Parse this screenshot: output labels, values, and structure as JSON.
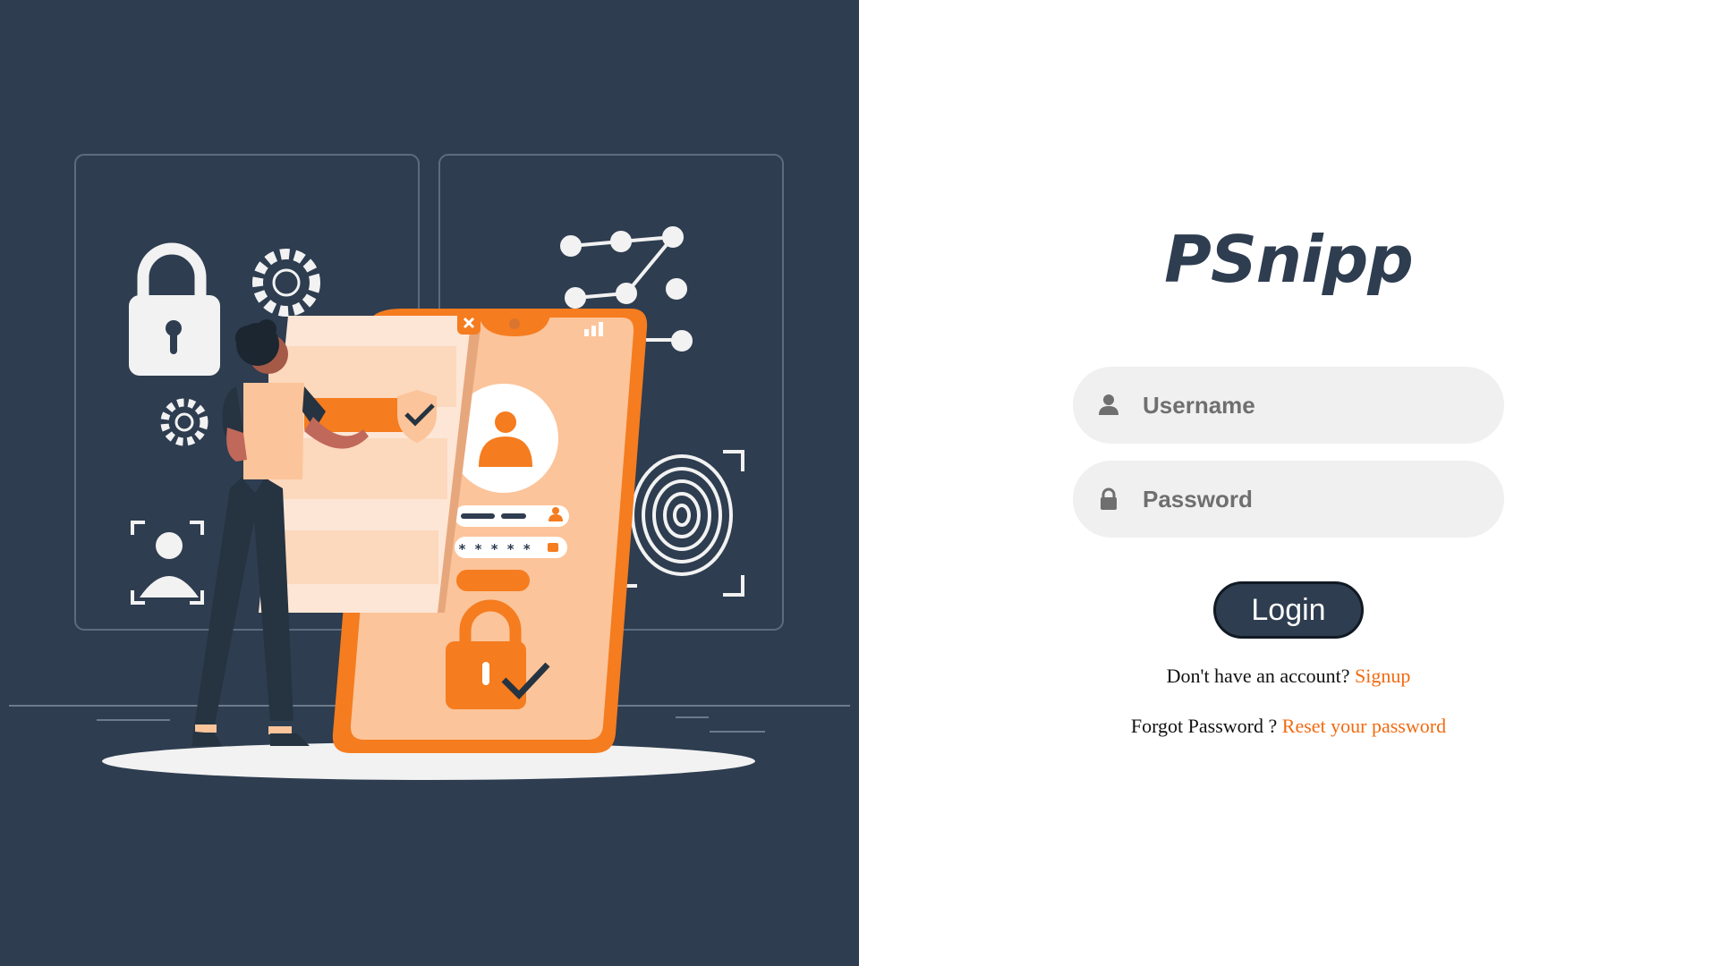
{
  "brand": {
    "title": "PSnipp"
  },
  "login_form": {
    "username_placeholder": "Username",
    "password_placeholder": "Password",
    "login_label": "Login",
    "signup_prompt": "Don't have an account?",
    "signup_link": "Signup",
    "forgot_prompt": "Forgot Password ?",
    "reset_link": "Reset your password"
  },
  "illustration": {
    "password_mask": "* * * * *"
  },
  "colors": {
    "panel_background": "#2e3d50",
    "accent": "#f26a10",
    "field_background": "#f0f0f0"
  },
  "icons": [
    "user-icon",
    "lock-icon",
    "padlock-icon",
    "gear-icon",
    "face-id-icon",
    "pattern-lock-icon",
    "fingerprint-icon",
    "shield-check-icon",
    "close-icon"
  ]
}
